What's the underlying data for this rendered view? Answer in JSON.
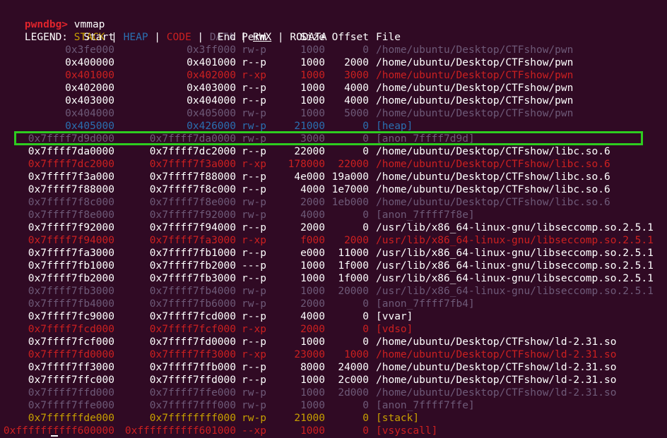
{
  "prompt": {
    "name": "pwndbg>",
    "command": "vmmap"
  },
  "legend": {
    "prefix": "LEGEND:",
    "stack": "STACK",
    "heap": "HEAP",
    "code": "CODE",
    "data": "DATA",
    "rwx": "RWX",
    "rodata": "RODATA",
    "sep": " | "
  },
  "headers": {
    "start": "Start",
    "end": "End",
    "perm": "Perm",
    "size": "Size",
    "offset": "Offset",
    "file": "File"
  },
  "colors": {
    "background": "#300a24",
    "rodata": "#ffffff",
    "data": "#6e5a78",
    "code": "#cc2020",
    "heap": "#2a6fb0",
    "stack": "#c8a000",
    "prompt": "#e0242c",
    "highlight_box": "#2ecc1f"
  },
  "highlighted_row_index": 7,
  "rows": [
    {
      "start": "0x3fe000",
      "end": "0x3ff000",
      "perm": "rw-p",
      "size": "1000",
      "offset": "0",
      "file": "/home/ubuntu/Desktop/CTFshow/pwn",
      "kind": "rw"
    },
    {
      "start": "0x400000",
      "end": "0x401000",
      "perm": "r--p",
      "size": "1000",
      "offset": "2000",
      "file": "/home/ubuntu/Desktop/CTFshow/pwn",
      "kind": "rodata"
    },
    {
      "start": "0x401000",
      "end": "0x402000",
      "perm": "r-xp",
      "size": "1000",
      "offset": "3000",
      "file": "/home/ubuntu/Desktop/CTFshow/pwn",
      "kind": "code"
    },
    {
      "start": "0x402000",
      "end": "0x403000",
      "perm": "r--p",
      "size": "1000",
      "offset": "4000",
      "file": "/home/ubuntu/Desktop/CTFshow/pwn",
      "kind": "rodata"
    },
    {
      "start": "0x403000",
      "end": "0x404000",
      "perm": "r--p",
      "size": "1000",
      "offset": "4000",
      "file": "/home/ubuntu/Desktop/CTFshow/pwn",
      "kind": "rodata"
    },
    {
      "start": "0x404000",
      "end": "0x405000",
      "perm": "rw-p",
      "size": "1000",
      "offset": "5000",
      "file": "/home/ubuntu/Desktop/CTFshow/pwn",
      "kind": "rw"
    },
    {
      "start": "0x405000",
      "end": "0x426000",
      "perm": "rw-p",
      "size": "21000",
      "offset": "0",
      "file": "[heap]",
      "kind": "heap"
    },
    {
      "start": "0x7ffff7d9d000",
      "end": "0x7ffff7da0000",
      "perm": "rw-p",
      "size": "3000",
      "offset": "0",
      "file": "[anon_7ffff7d9d]",
      "kind": "rw"
    },
    {
      "start": "0x7ffff7da0000",
      "end": "0x7ffff7dc2000",
      "perm": "r--p",
      "size": "22000",
      "offset": "0",
      "file": "/home/ubuntu/Desktop/CTFshow/libc.so.6",
      "kind": "rodata"
    },
    {
      "start": "0x7ffff7dc2000",
      "end": "0x7ffff7f3a000",
      "perm": "r-xp",
      "size": "178000",
      "offset": "22000",
      "file": "/home/ubuntu/Desktop/CTFshow/libc.so.6",
      "kind": "code"
    },
    {
      "start": "0x7ffff7f3a000",
      "end": "0x7ffff7f88000",
      "perm": "r--p",
      "size": "4e000",
      "offset": "19a000",
      "file": "/home/ubuntu/Desktop/CTFshow/libc.so.6",
      "kind": "rodata"
    },
    {
      "start": "0x7ffff7f88000",
      "end": "0x7ffff7f8c000",
      "perm": "r--p",
      "size": "4000",
      "offset": "1e7000",
      "file": "/home/ubuntu/Desktop/CTFshow/libc.so.6",
      "kind": "rodata"
    },
    {
      "start": "0x7ffff7f8c000",
      "end": "0x7ffff7f8e000",
      "perm": "rw-p",
      "size": "2000",
      "offset": "1eb000",
      "file": "/home/ubuntu/Desktop/CTFshow/libc.so.6",
      "kind": "rw"
    },
    {
      "start": "0x7ffff7f8e000",
      "end": "0x7ffff7f92000",
      "perm": "rw-p",
      "size": "4000",
      "offset": "0",
      "file": "[anon_7ffff7f8e]",
      "kind": "rw"
    },
    {
      "start": "0x7ffff7f92000",
      "end": "0x7ffff7f94000",
      "perm": "r--p",
      "size": "2000",
      "offset": "0",
      "file": "/usr/lib/x86_64-linux-gnu/libseccomp.so.2.5.1",
      "kind": "rodata"
    },
    {
      "start": "0x7ffff7f94000",
      "end": "0x7ffff7fa3000",
      "perm": "r-xp",
      "size": "f000",
      "offset": "2000",
      "file": "/usr/lib/x86_64-linux-gnu/libseccomp.so.2.5.1",
      "kind": "code"
    },
    {
      "start": "0x7ffff7fa3000",
      "end": "0x7ffff7fb1000",
      "perm": "r--p",
      "size": "e000",
      "offset": "11000",
      "file": "/usr/lib/x86_64-linux-gnu/libseccomp.so.2.5.1",
      "kind": "rodata"
    },
    {
      "start": "0x7ffff7fb1000",
      "end": "0x7ffff7fb2000",
      "perm": "---p",
      "size": "1000",
      "offset": "1f000",
      "file": "/usr/lib/x86_64-linux-gnu/libseccomp.so.2.5.1",
      "kind": "rodata"
    },
    {
      "start": "0x7ffff7fb2000",
      "end": "0x7ffff7fb3000",
      "perm": "r--p",
      "size": "1000",
      "offset": "1f000",
      "file": "/usr/lib/x86_64-linux-gnu/libseccomp.so.2.5.1",
      "kind": "rodata"
    },
    {
      "start": "0x7ffff7fb3000",
      "end": "0x7ffff7fb4000",
      "perm": "rw-p",
      "size": "1000",
      "offset": "20000",
      "file": "/usr/lib/x86_64-linux-gnu/libseccomp.so.2.5.1",
      "kind": "rw"
    },
    {
      "start": "0x7ffff7fb4000",
      "end": "0x7ffff7fb6000",
      "perm": "rw-p",
      "size": "2000",
      "offset": "0",
      "file": "[anon_7ffff7fb4]",
      "kind": "rw"
    },
    {
      "start": "0x7ffff7fc9000",
      "end": "0x7ffff7fcd000",
      "perm": "r--p",
      "size": "4000",
      "offset": "0",
      "file": "[vvar]",
      "kind": "rodata"
    },
    {
      "start": "0x7ffff7fcd000",
      "end": "0x7ffff7fcf000",
      "perm": "r-xp",
      "size": "2000",
      "offset": "0",
      "file": "[vdso]",
      "kind": "code"
    },
    {
      "start": "0x7ffff7fcf000",
      "end": "0x7ffff7fd0000",
      "perm": "r--p",
      "size": "1000",
      "offset": "0",
      "file": "/home/ubuntu/Desktop/CTFshow/ld-2.31.so",
      "kind": "rodata"
    },
    {
      "start": "0x7ffff7fd0000",
      "end": "0x7ffff7ff3000",
      "perm": "r-xp",
      "size": "23000",
      "offset": "1000",
      "file": "/home/ubuntu/Desktop/CTFshow/ld-2.31.so",
      "kind": "code"
    },
    {
      "start": "0x7ffff7ff3000",
      "end": "0x7ffff7ffb000",
      "perm": "r--p",
      "size": "8000",
      "offset": "24000",
      "file": "/home/ubuntu/Desktop/CTFshow/ld-2.31.so",
      "kind": "rodata"
    },
    {
      "start": "0x7ffff7ffc000",
      "end": "0x7ffff7ffd000",
      "perm": "r--p",
      "size": "1000",
      "offset": "2c000",
      "file": "/home/ubuntu/Desktop/CTFshow/ld-2.31.so",
      "kind": "rodata"
    },
    {
      "start": "0x7ffff7ffd000",
      "end": "0x7ffff7ffe000",
      "perm": "rw-p",
      "size": "1000",
      "offset": "2d000",
      "file": "/home/ubuntu/Desktop/CTFshow/ld-2.31.so",
      "kind": "rw"
    },
    {
      "start": "0x7ffff7ffe000",
      "end": "0x7ffff7fff000",
      "perm": "rw-p",
      "size": "1000",
      "offset": "0",
      "file": "[anon_7ffff7ffe]",
      "kind": "rw"
    },
    {
      "start": "0x7ffffffde000",
      "end": "0x7ffffffff000",
      "perm": "rw-p",
      "size": "21000",
      "offset": "0",
      "file": "[stack]",
      "kind": "stack"
    },
    {
      "start": "0xffffffffff600000",
      "end": "0xffffffffff601000",
      "perm": "--xp",
      "size": "1000",
      "offset": "0",
      "file": "[vsyscall]",
      "kind": "code"
    }
  ]
}
